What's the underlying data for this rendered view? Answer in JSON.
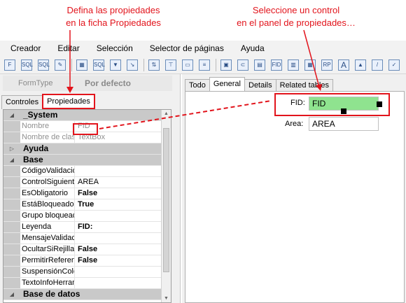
{
  "callouts": {
    "left": {
      "line1": "Defina las propiedades",
      "line2": "en la ficha Propiedades"
    },
    "right": {
      "line1": "Seleccione un control",
      "line2": "en el panel de propiedades…"
    }
  },
  "menu": [
    "Creador",
    "Editar",
    "Selección",
    "Selector de páginas",
    "Ayuda"
  ],
  "toolbar": {
    "icons": [
      "form-sql-icon",
      "db-sql-icon",
      "select-sql-icon",
      "edit-script-icon",
      "table-icon",
      "query-icon",
      "filter-icon",
      "export-icon",
      "import-icon",
      "tab-order-icon",
      "layout-icon",
      "page-icon",
      "document-icon",
      "clip-icon",
      "grid-icon",
      "fid-icon",
      "image-field-icon",
      "table-field-icon",
      "report-icon",
      "text-icon",
      "image-icon",
      "line-icon",
      "checkbox-icon",
      "more-icon"
    ]
  },
  "left_panel": {
    "formtype_label": "FormType",
    "formtype_value": "Por defecto",
    "tabs": [
      "Controles",
      "Propiedades"
    ],
    "active_tab": "Propiedades"
  },
  "properties": {
    "system": {
      "category": "_System",
      "rows": [
        {
          "name": "Nombre",
          "value": "FID"
        },
        {
          "name": "Nombre de clase",
          "value": "TextBox"
        }
      ]
    },
    "ayuda": {
      "category": "Ayuda"
    },
    "base": {
      "category": "Base",
      "rows": [
        {
          "name": "CódigoValidación",
          "value": ""
        },
        {
          "name": "ControlSiguiente",
          "value": "AREA"
        },
        {
          "name": "EsObligatorio",
          "value": "False"
        },
        {
          "name": "EstáBloqueado",
          "value": "True"
        },
        {
          "name": "Grupo bloqueado",
          "value": ""
        },
        {
          "name": "Leyenda",
          "value": "FID:"
        },
        {
          "name": "MensajeValidación",
          "value": ""
        },
        {
          "name": "OcultarSiRejilla",
          "value": "False"
        },
        {
          "name": "PermitirReferencia",
          "value": "False"
        },
        {
          "name": "SuspensiónColor",
          "value": ""
        },
        {
          "name": "TextoInfoHerramienta",
          "value": ""
        }
      ]
    },
    "basedatos": {
      "category": "Base de datos"
    }
  },
  "right_panel": {
    "tabs": [
      "Todo",
      "General",
      "Details",
      "Related tables"
    ],
    "active_tab": "General",
    "fields": {
      "fid_label": "FID:",
      "fid_value": "FID",
      "area_label": "Area:",
      "area_value": "AREA"
    }
  },
  "colors": {
    "callout_red": "#e2141c",
    "selected_field": "#8fe38f",
    "category_gray": "#c9c9c9"
  }
}
